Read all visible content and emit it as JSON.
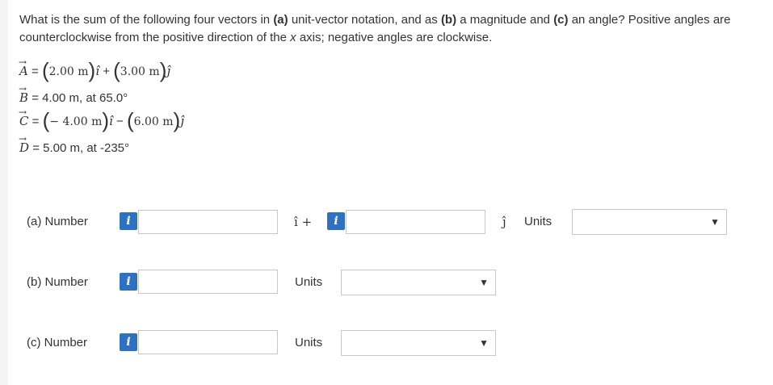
{
  "question": {
    "lead": "What is the sum of the following four vectors in ",
    "a_tag": "(a)",
    "a_text": " unit-vector notation, and as ",
    "b_tag": "(b)",
    "b_text": " a magnitude and ",
    "c_tag": "(c)",
    "c_text": " an angle? Positive angles are counterclockwise from the positive direction of the ",
    "x_axis": "x",
    "tail": " axis; negative angles are clockwise."
  },
  "vectors": {
    "A": {
      "name": "A",
      "x": "2.00 m",
      "y": "3.00 m",
      "op_mid": "+"
    },
    "B": {
      "name": "B",
      "text": " = 4.00 m, at 65.0°"
    },
    "C": {
      "name": "C",
      "x": "− 4.00 m",
      "y": "6.00 m",
      "op_mid": "−"
    },
    "D": {
      "name": "D",
      "text": " = 5.00 m, at -235°"
    }
  },
  "rows": {
    "a": {
      "label": "(a)  Number",
      "i_hat": "î +",
      "j_hat": "ĵ",
      "units": "Units",
      "value_x": "",
      "value_y": "",
      "unit_selected": ""
    },
    "b": {
      "label": "(b)  Number",
      "units": "Units",
      "value": "",
      "unit_selected": ""
    },
    "c": {
      "label": "(c)  Number",
      "units": "Units",
      "value": "",
      "unit_selected": ""
    }
  },
  "info_glyph": "i",
  "colors": {
    "info": "#2f71c1",
    "border": "#c8c8c8"
  },
  "icons": [
    "info-icon",
    "chevron-down-icon"
  ]
}
